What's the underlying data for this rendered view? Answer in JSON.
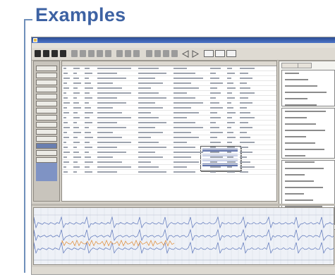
{
  "heading": "Examples",
  "colors": {
    "heading": "#3d62a3",
    "frame": "#6f8fba",
    "window_title": "#2b4d93",
    "selection": "#6a7fb0",
    "trace_blue": "#5a74b9",
    "trace_orange": "#e08a32"
  },
  "icons": [
    "app-icon",
    "toolbar-icons",
    "back-arrow-icon",
    "forward-arrow-icon"
  ],
  "window": {
    "title": "",
    "menu": []
  },
  "sidebar": {
    "items": [
      "",
      "",
      "",
      "",
      "",
      "",
      "",
      "",
      "",
      "",
      "",
      "",
      "",
      ""
    ]
  },
  "table": {
    "rows": 22,
    "columns": 9
  },
  "status_text": ""
}
